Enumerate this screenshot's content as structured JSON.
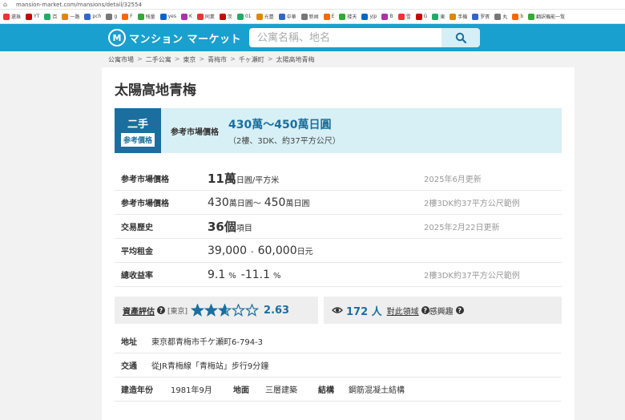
{
  "browser": {
    "url": "mansion-market.com/mansions/detail/32554",
    "bookmarks": [
      "還珠",
      "YT",
      "百",
      "一路",
      "pch",
      "g",
      "F",
      "残量",
      "yes",
      "K",
      "同業",
      "茨",
      "01",
      "光豊",
      "中華",
      "新闻",
      "E",
      "楼天",
      "yjp",
      "B",
      "雪",
      "G",
      "東",
      "手機",
      "罗賓",
      "丸",
      "b",
      "翻訳機能一覧"
    ]
  },
  "header": {
    "logo_text": "マンション マーケット",
    "search_placeholder": "公寓名稱、地名"
  },
  "breadcrumb": [
    "公寓市場",
    "二手公寓",
    "東京",
    "青梅市",
    "千ヶ瀬町",
    "太陽高地青梅"
  ],
  "title": "太陽高地青梅",
  "banner": {
    "tag_top": "二手",
    "tag_bottom": "参考價格",
    "label": "参考市場價格",
    "price": "430萬～450萬日圓",
    "sub": "（2樓、3DK、約37平方公尺）"
  },
  "table": {
    "unit_price": {
      "label": "参考市場價格",
      "value": "11萬",
      "unit": "日圓/平方米",
      "note": "2025年6月更新"
    },
    "range_price": {
      "label": "参考市場價格",
      "low": "430",
      "low_unit": "萬日圓～",
      "high": "450",
      "high_unit": "萬日圓",
      "note": "2樓3DK約37平方公尺範例"
    },
    "history": {
      "label": "交易歷史",
      "value": "36個",
      "unit": "項目",
      "note": "2025年2月22日更新"
    },
    "rent": {
      "label": "平均租金",
      "low": "39,000",
      "sep": "-",
      "high": "60,000",
      "unit": "日元"
    },
    "yield": {
      "label": "總收益率",
      "low": "9.1",
      "low_unit": "%",
      "high": "-11.1",
      "high_unit": "%",
      "note": "2樓3DK約37平方公尺範例"
    }
  },
  "rating": {
    "label": "資產評估",
    "region": "[東京]",
    "stars": 2.63,
    "score": "2.63"
  },
  "views": {
    "count": "172 人",
    "link": "對此領域",
    "suffix": "感興趣"
  },
  "info": {
    "address_label": "地址",
    "address": "東京都青梅市千ケ瀬町6-794-3",
    "access_label": "交通",
    "access": "從JR青梅線「青梅站」步行9分鐘",
    "built_label": "建造年份",
    "built": "1981年9月",
    "floors_label": "地面",
    "floors": "三層建築",
    "structure_label": "結構",
    "structure": "鋼筋混凝土結構"
  },
  "colors": {
    "header_bg": "#1aa0cf",
    "accent": "#1a6f9e",
    "banner_bg": "#d7f0f5",
    "star": "#1a6f9e"
  }
}
